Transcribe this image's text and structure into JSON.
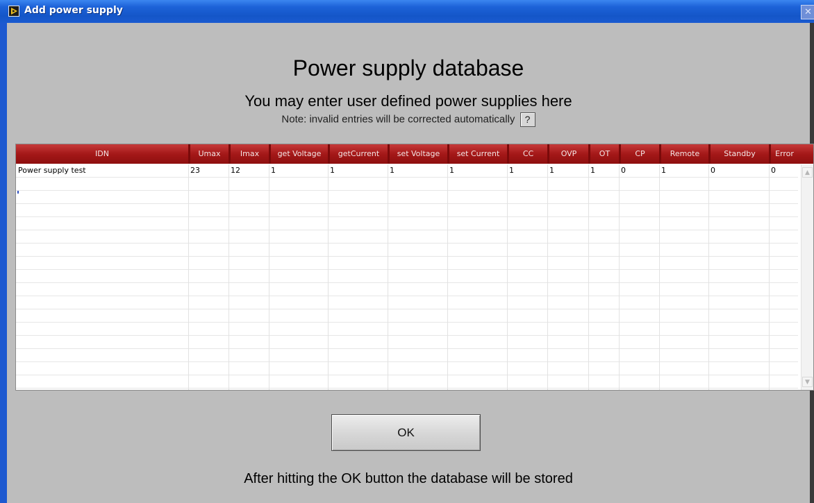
{
  "window": {
    "title": "Add power supply",
    "close_label": "✕"
  },
  "header": {
    "title": "Power supply database",
    "subtitle": "You may enter user defined power supplies here",
    "note": "Note: invalid entries will be corrected automatically",
    "help_label": "?"
  },
  "table": {
    "columns": [
      "IDN",
      "Umax",
      "Imax",
      "get Voltage",
      "getCurrent",
      "set Voltage",
      "set Current",
      "CC",
      "OVP",
      "OT",
      "CP",
      "Remote",
      "Standby",
      "Error"
    ],
    "rows": [
      [
        "Power supply test",
        "23",
        "12",
        "1",
        "1",
        "1",
        "1",
        "1",
        "1",
        "1",
        "0",
        "1",
        "0",
        "0"
      ]
    ],
    "scroll_up": "▲",
    "scroll_down": "▼"
  },
  "buttons": {
    "ok_label": "OK"
  },
  "footer": {
    "text": "After hitting the OK button the database will be stored"
  },
  "colors": {
    "header_red": "#a41818",
    "window_blue": "#1d62d8",
    "panel_gray": "#bdbdbd"
  }
}
